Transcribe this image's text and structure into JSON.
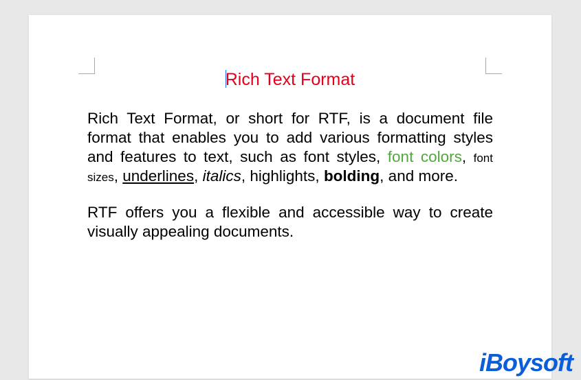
{
  "document": {
    "title": "Rich Text Format",
    "paragraphs": [
      {
        "segments": [
          {
            "text": "Rich Text Format, or short for RTF, is a document file format that enables you to add various formatting styles and features to text, such as font styles, ",
            "style": "normal"
          },
          {
            "text": "font colors",
            "style": "font-colors"
          },
          {
            "text": ", ",
            "style": "normal"
          },
          {
            "text": "font sizes",
            "style": "font-sizes"
          },
          {
            "text": ", ",
            "style": "normal"
          },
          {
            "text": "underlines",
            "style": "underlines"
          },
          {
            "text": ", ",
            "style": "normal"
          },
          {
            "text": "italics",
            "style": "italics"
          },
          {
            "text": ", highlights, ",
            "style": "normal"
          },
          {
            "text": "bolding",
            "style": "bolding"
          },
          {
            "text": ", and more.",
            "style": "normal"
          }
        ]
      },
      {
        "segments": [
          {
            "text": "RTF offers you a flexible and accessible way to create visually appealing documents.",
            "style": "normal"
          }
        ]
      }
    ]
  },
  "watermark": {
    "brand": "iBoysoft"
  },
  "colors": {
    "title": "#e4001c",
    "fontColors": "#4fa83d",
    "brand": "#0b5ed7"
  }
}
